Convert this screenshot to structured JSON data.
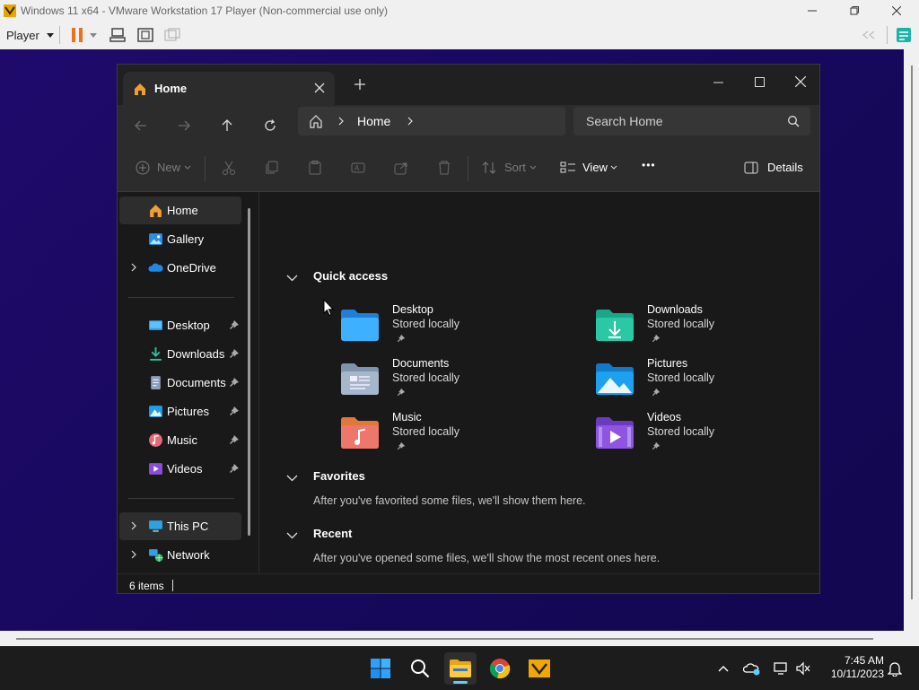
{
  "vmware": {
    "window_title": "Windows 11 x64 - VMware Workstation 17 Player (Non-commercial use only)",
    "player_menu": "Player"
  },
  "explorer": {
    "tab_title": "Home",
    "breadcrumb": [
      "Home"
    ],
    "search_placeholder": "Search Home",
    "toolbar": {
      "new_label": "New",
      "sort_label": "Sort",
      "view_label": "View",
      "more_label": "•••",
      "details_label": "Details"
    },
    "nav": {
      "top_items": [
        {
          "label": "Home",
          "icon": "home-icon",
          "selected": true
        },
        {
          "label": "Gallery",
          "icon": "gallery-icon"
        },
        {
          "label": "OneDrive",
          "icon": "onedrive-icon",
          "expandable": true
        }
      ],
      "pinned_items": [
        {
          "label": "Desktop",
          "icon": "desktop-folder-icon"
        },
        {
          "label": "Downloads",
          "icon": "downloads-folder-icon"
        },
        {
          "label": "Documents",
          "icon": "documents-folder-icon"
        },
        {
          "label": "Pictures",
          "icon": "pictures-folder-icon"
        },
        {
          "label": "Music",
          "icon": "music-folder-icon"
        },
        {
          "label": "Videos",
          "icon": "videos-folder-icon"
        }
      ],
      "bottom_items": [
        {
          "label": "This PC",
          "icon": "this-pc-icon",
          "expandable": true,
          "selected": true
        },
        {
          "label": "Network",
          "icon": "network-icon",
          "expandable": true
        }
      ]
    },
    "sections": {
      "quick_access": "Quick access",
      "favorites": "Favorites",
      "favorites_message": "After you've favorited some files, we'll show them here.",
      "recent": "Recent",
      "recent_message": "After you've opened some files, we'll show the most recent ones here."
    },
    "quick_access_items": [
      {
        "name": "Desktop",
        "status": "Stored locally",
        "icon": "desktop-folder-icon"
      },
      {
        "name": "Downloads",
        "status": "Stored locally",
        "icon": "downloads-folder-icon"
      },
      {
        "name": "Documents",
        "status": "Stored locally",
        "icon": "documents-folder-icon"
      },
      {
        "name": "Pictures",
        "status": "Stored locally",
        "icon": "pictures-folder-icon"
      },
      {
        "name": "Music",
        "status": "Stored locally",
        "icon": "music-folder-icon"
      },
      {
        "name": "Videos",
        "status": "Stored locally",
        "icon": "videos-folder-icon"
      }
    ],
    "status_bar": "6 items"
  },
  "taskbar": {
    "apps": [
      "start-icon",
      "search-icon",
      "file-explorer-icon",
      "chrome-icon",
      "vmware-tools-icon"
    ],
    "time": "7:45 AM",
    "date": "10/11/2023"
  },
  "colors": {
    "accent": "#60cdff",
    "window_bg": "#191919",
    "toolbar_bg": "#2c2c2c",
    "desktop_bg": "#1f0a6b"
  }
}
